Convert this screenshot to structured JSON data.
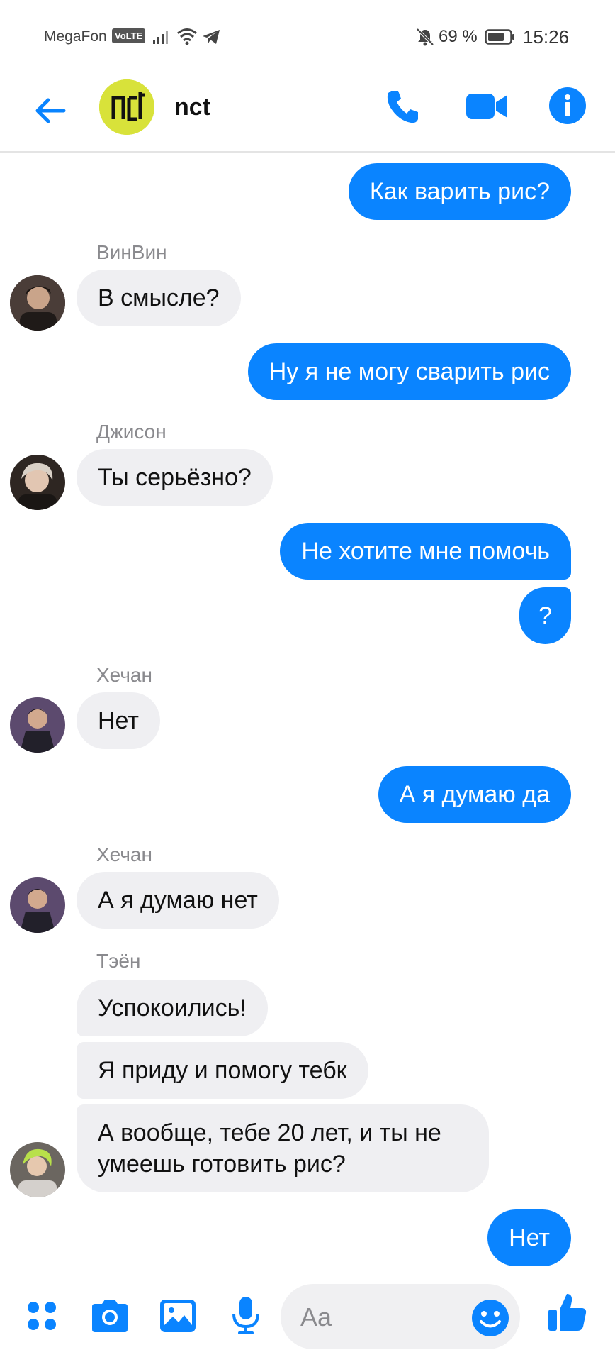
{
  "status_bar": {
    "carrier": "MegaFon",
    "volte": "VoLTE",
    "battery_percent": "69 %",
    "time": "15:26"
  },
  "header": {
    "title": "nct",
    "avatar_text": "nct"
  },
  "messages": [
    {
      "dir": "out",
      "text": "Как варить рис?"
    },
    {
      "dir": "in",
      "sender": "ВинВин",
      "text": "В смысле?"
    },
    {
      "dir": "out",
      "text": "Ну я не могу сварить рис"
    },
    {
      "dir": "in",
      "sender": "Джисон",
      "text": "Ты серьёзно?"
    },
    {
      "dir": "out",
      "text": "Не хотите мне помочь"
    },
    {
      "dir": "out",
      "text": "?"
    },
    {
      "dir": "in",
      "sender": "Хечан",
      "text": "Нет"
    },
    {
      "dir": "out",
      "text": "А я думаю да"
    },
    {
      "dir": "in",
      "sender": "Хечан",
      "text": "А я думаю нет"
    },
    {
      "dir": "in",
      "sender": "Тэён",
      "text": "Успокоились!"
    },
    {
      "dir": "in",
      "text": "Я приду и помогу тебк"
    },
    {
      "dir": "in",
      "text": "А вообще, тебе 20 лет, и ты не умеешь готовить рис?"
    },
    {
      "dir": "out",
      "text": "Нет"
    }
  ],
  "composer": {
    "placeholder": "Aa",
    "icons": [
      "menu-icon",
      "camera-icon",
      "gallery-icon",
      "mic-icon",
      "emoji-icon",
      "like-icon"
    ]
  },
  "colors": {
    "accent": "#0a84ff",
    "incoming_bubble": "#efeff2",
    "avatar_lime": "#d8e23a"
  }
}
